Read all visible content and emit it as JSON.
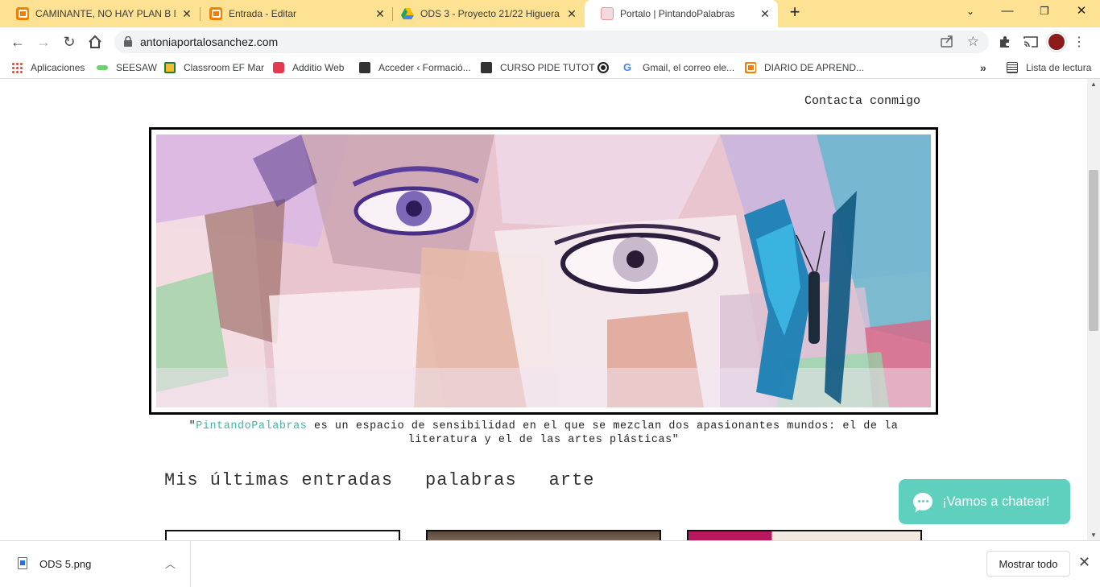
{
  "tabs": [
    {
      "title": "CAMINANTE, NO HAY PLAN B NI",
      "icon": "blogger-icon",
      "active": false
    },
    {
      "title": "Entrada - Editar",
      "icon": "blogger-icon",
      "active": false
    },
    {
      "title": "ODS 3 - Proyecto 21/22 Higuera",
      "icon": "google-drive-icon",
      "active": false
    },
    {
      "title": "Portalo | PintandoPalabras",
      "icon": "site-favicon-icon",
      "active": true
    }
  ],
  "address_bar": {
    "url": "antoniaportalosanchez.com"
  },
  "bookmarks": {
    "apps": "Aplicaciones",
    "items": [
      "SEESAW",
      "Classroom EF Mar",
      "Additio Web",
      "Acceder ‹ Formació...",
      "CURSO PIDE TUTOT",
      "",
      "Gmail, el correo ele...",
      "DIARIO DE APREND..."
    ],
    "more": "»",
    "reading_list": "Lista de lectura"
  },
  "page": {
    "contact_link": "Contacta conmigo",
    "tagline_open": "\"",
    "tagline_brand": "PintandoPalabras",
    "tagline_rest": " es un espacio de sensibilidad en el que se mezclan dos apasionantes mundos: el de la literatura y el de las artes plásticas\"",
    "nav": [
      "Mis últimas entradas",
      "palabras",
      "arte"
    ],
    "chat_button": "¡Vamos a chatear!"
  },
  "downloads": {
    "file_name": "ODS 5.png",
    "show_all": "Mostrar todo"
  },
  "colors": {
    "tabstrip": "#fde293",
    "accent_teal": "#3bb5a5",
    "chat_bg": "#5fcfbe"
  }
}
